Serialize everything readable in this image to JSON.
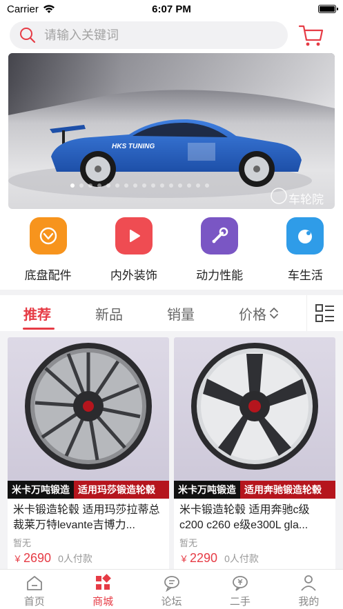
{
  "status_bar": {
    "carrier": "Carrier",
    "time": "6:07 PM"
  },
  "search": {
    "placeholder": "请输入关键词"
  },
  "banner": {
    "watermark": "车轮院",
    "dot_count": 16,
    "active_dot": 0
  },
  "categories": [
    {
      "label": "底盘配件",
      "icon": "chassis-icon",
      "color": "#f7941d"
    },
    {
      "label": "内外装饰",
      "icon": "play-icon",
      "color": "#ef4c52"
    },
    {
      "label": "动力性能",
      "icon": "wrench-icon",
      "color": "#7a56c4"
    },
    {
      "label": "车生活",
      "icon": "bubble-icon",
      "color": "#2f9ce8"
    }
  ],
  "tabs": [
    {
      "label": "推荐",
      "active": true
    },
    {
      "label": "新品",
      "active": false
    },
    {
      "label": "销量",
      "active": false
    },
    {
      "label": "价格",
      "active": false
    }
  ],
  "products": [
    {
      "tag_left": "米卡万吨锻造",
      "tag_right": "适用玛莎锻造轮毂",
      "title": "米卡锻造轮毂 适用玛莎拉蒂总裁莱万特levante吉博力...",
      "subtitle": "暂无",
      "currency": "￥",
      "price": "2690",
      "buyers": "0人付款"
    },
    {
      "tag_left": "米卡万吨锻造",
      "tag_right": "适用奔驰锻造轮毂",
      "title": "米卡锻造轮毂 适用奔驰c级c200 c260 e级e300L gla...",
      "subtitle": "暂无",
      "currency": "￥",
      "price": "2290",
      "buyers": "0人付款"
    }
  ],
  "bottom_nav": [
    {
      "label": "首页",
      "icon": "home-icon",
      "active": false
    },
    {
      "label": "商城",
      "icon": "store-icon",
      "active": true
    },
    {
      "label": "论坛",
      "icon": "forum-icon",
      "active": false
    },
    {
      "label": "二手",
      "icon": "secondhand-icon",
      "active": false
    },
    {
      "label": "我的",
      "icon": "profile-icon",
      "active": false
    }
  ],
  "colors": {
    "accent": "#e63b45",
    "tag_dark": "#111111",
    "tag_red": "#b5151d"
  }
}
